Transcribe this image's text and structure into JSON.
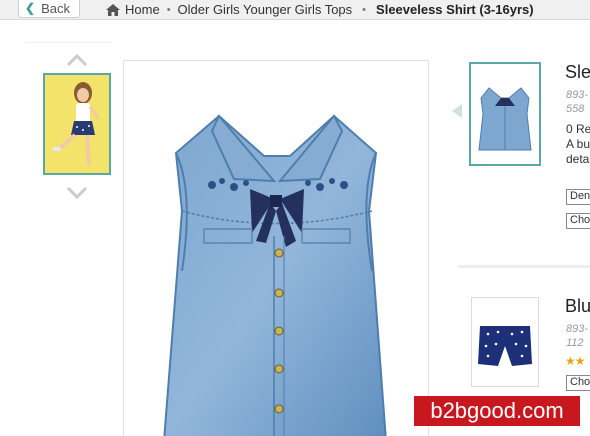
{
  "topbar": {
    "back_label": "Back",
    "breadcrumb": {
      "home": "Home",
      "category": "Older Girls Younger Girls Tops",
      "current": "Sleeveless Shirt (3-16yrs)"
    }
  },
  "related": {
    "item1": {
      "title": "Sle",
      "code_line1": "893-",
      "code_line2": "558",
      "reviews": "0 Re",
      "desc_line1": "A bu",
      "desc_line2": "deta",
      "select1": "Den",
      "select2": "Cho"
    },
    "item2": {
      "title": "Blu",
      "code_line1": "893-",
      "code_line2": "112",
      "select1": "Cho",
      "rating": 2
    }
  },
  "watermark": "b2bgood.com",
  "colors": {
    "accent_teal": "#5aa9a4",
    "denim": "#6f9cc9",
    "watermark_red": "#c8171e"
  }
}
